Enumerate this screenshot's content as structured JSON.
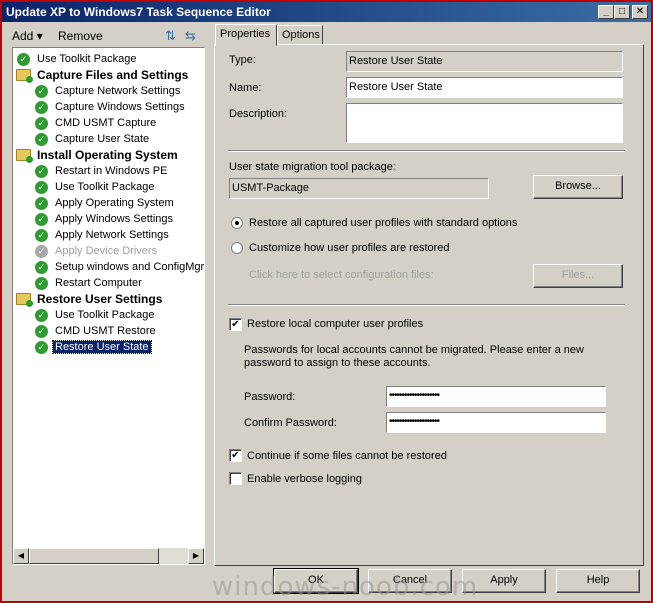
{
  "window": {
    "title": "Update XP to Windows7 Task Sequence Editor"
  },
  "menu": {
    "add": "Add",
    "remove": "Remove"
  },
  "tree": {
    "items": [
      {
        "label": "Use Toolkit Package",
        "kind": "step"
      },
      {
        "label": "Capture Files and Settings",
        "kind": "group"
      },
      {
        "label": "Capture Network Settings",
        "kind": "step"
      },
      {
        "label": "Capture Windows Settings",
        "kind": "step"
      },
      {
        "label": "CMD USMT Capture",
        "kind": "step"
      },
      {
        "label": "Capture User State",
        "kind": "step"
      },
      {
        "label": "Install Operating System",
        "kind": "group"
      },
      {
        "label": "Restart in Windows PE",
        "kind": "step"
      },
      {
        "label": "Use Toolkit Package",
        "kind": "step"
      },
      {
        "label": "Apply Operating System",
        "kind": "step"
      },
      {
        "label": "Apply Windows Settings",
        "kind": "step"
      },
      {
        "label": "Apply Network Settings",
        "kind": "step"
      },
      {
        "label": "Apply Device Drivers",
        "kind": "disabled"
      },
      {
        "label": "Setup windows and ConfigMgr",
        "kind": "step"
      },
      {
        "label": "Restart Computer",
        "kind": "step"
      },
      {
        "label": "Restore User Settings",
        "kind": "group"
      },
      {
        "label": "Use Toolkit Package",
        "kind": "step"
      },
      {
        "label": "CMD USMT Restore",
        "kind": "step"
      },
      {
        "label": "Restore User State",
        "kind": "selected"
      }
    ]
  },
  "tabs": {
    "properties": "Properties",
    "options": "Options"
  },
  "props": {
    "type_label": "Type:",
    "type_value": "Restore User State",
    "name_label": "Name:",
    "name_value": "Restore User State",
    "description_label": "Description:",
    "description_value": "",
    "package_label": "User state migration tool package:",
    "package_value": "USMT-Package",
    "browse": "Browse...",
    "radio_all": "Restore all captured user profiles with standard options",
    "radio_custom": "Customize how user profiles are restored",
    "config_files_hint": "Click here to select configuration files:",
    "files": "Files...",
    "restore_local": "Restore local computer user profiles",
    "passwords_note": "Passwords for local accounts cannot be migrated. Please enter a new password to assign to these accounts.",
    "password_label": "Password:",
    "password_value": "••••••••••••••••••••",
    "confirm_label": "Confirm Password:",
    "confirm_value": "••••••••••••••••••••",
    "continue_label": "Continue if some files cannot be restored",
    "verbose_label": "Enable verbose logging"
  },
  "buttons": {
    "ok": "OK",
    "cancel": "Cancel",
    "apply": "Apply",
    "help": "Help"
  },
  "watermark": "windows-noob.com"
}
